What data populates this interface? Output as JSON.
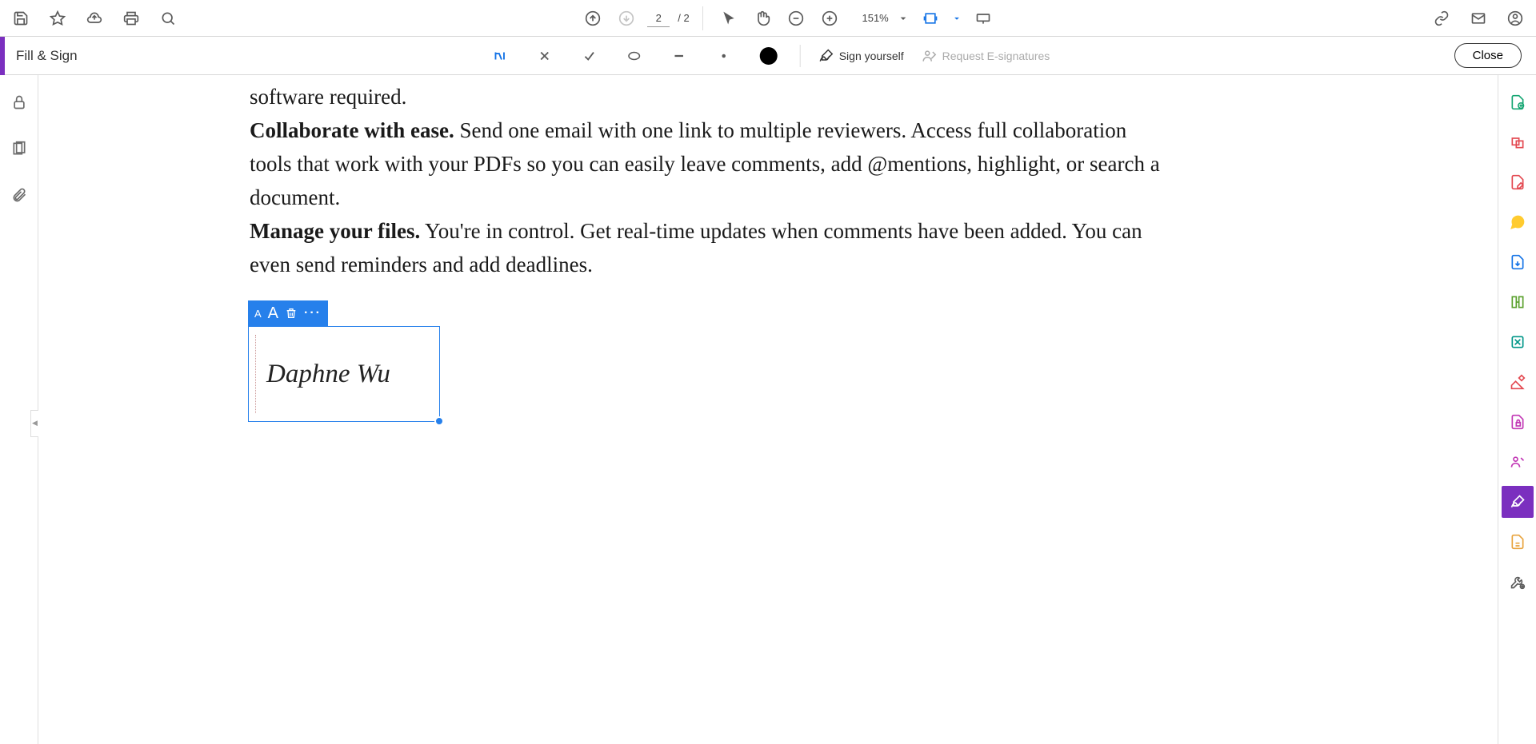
{
  "top": {
    "page_current": "2",
    "page_total": "/ 2",
    "zoom": "151%"
  },
  "fillSign": {
    "title": "Fill & Sign",
    "sign_yourself": "Sign yourself",
    "request_esig": "Request E-signatures",
    "close": "Close"
  },
  "doc": {
    "p0_tail": "software required.",
    "p1_bold": "Collaborate with ease.",
    "p1_rest": " Send one email with one link to multiple reviewers. Access full collaboration tools that work with your PDFs so you can easily leave comments, add @mentions, highlight, or search a document.",
    "p2_bold": "Manage your files.",
    "p2_rest": " You're in control. Get real-time updates when comments have been added. You can even send reminders and add deadlines."
  },
  "signature": {
    "text": "Daphne Wu",
    "toolbar": {
      "smallA": "A",
      "bigA": "A",
      "more": "···"
    }
  }
}
